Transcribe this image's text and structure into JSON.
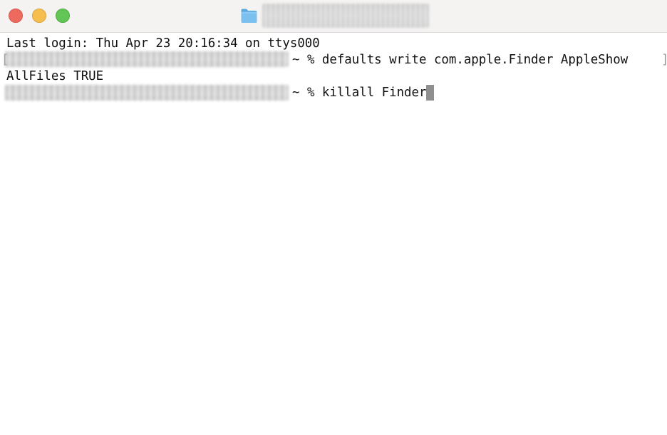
{
  "window": {
    "title_icon": "folder-icon",
    "colors": {
      "close": "#ee6a5f",
      "minimize": "#f5be4f",
      "zoom": "#62c555",
      "titlebar": "#f4f3f2",
      "cursor": "#8f8f8f"
    }
  },
  "terminal": {
    "last_login": "Last login: Thu Apr 23 20:16:34 on ttys000",
    "command1_prompt_suffix": "~ % ",
    "command1": "defaults write com.apple.Finder AppleShow",
    "command1_wrap": "AllFiles TRUE",
    "command2_prompt_suffix": "~ % ",
    "command2": "killall Finder",
    "bracket_open": "[",
    "bracket_close": "]"
  }
}
